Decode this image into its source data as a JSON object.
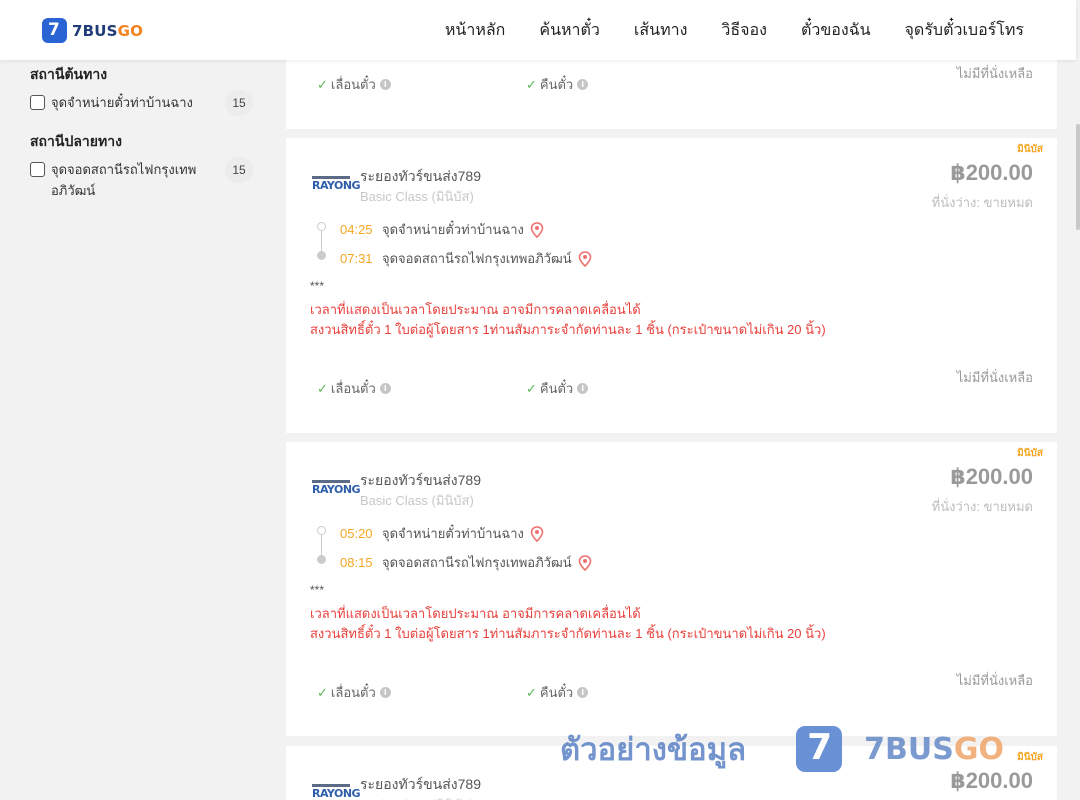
{
  "brand": {
    "mark": "7",
    "name_a": "7BUS",
    "name_b": "GO"
  },
  "nav": [
    "หน้าหลัก",
    "ค้นหาตั๋ว",
    "เส้นทาง",
    "วิธีจอง",
    "ตั๋วของฉัน",
    "จุดรับตั๋วเบอร์โทร"
  ],
  "filters": {
    "origin_title": "สถานีต้นทาง",
    "origin_items": [
      {
        "label": "จุดจำหน่ายตั๋วท่าบ้านฉาง",
        "count": "15"
      }
    ],
    "dest_title": "สถานีปลายทาง",
    "dest_items": [
      {
        "label": "จุดจอดสถานีรถไฟกรุงเทพอภิวัฒน์",
        "count": "15"
      }
    ]
  },
  "partial_card": {
    "reschedule": "เลื่อนตั๋ว",
    "refund": "คืนตั๋ว",
    "availability": "ไม่มีที่นั่งเหลือ"
  },
  "trips": [
    {
      "vehicle_tag": "มินิบัส",
      "operator_logo": "RAYONG",
      "operator": "ระยองทัวร์ขนส่ง789",
      "class": "Basic Class (มินิบัส)",
      "price": "฿200.00",
      "seats": "ที่นั่งว่าง: ขายหมด",
      "depart_time": "04:25",
      "depart_place": "จุดจำหน่ายตั๋วท่าบ้านฉาง",
      "arrive_time": "07:31",
      "arrive_place": "จุดจอดสถานีรถไฟกรุงเทพอภิวัฒน์",
      "note_stars": "***",
      "note1": "เวลาที่แสดงเป็นเวลาโดยประมาณ อาจมีการคลาดเคลื่อนได้",
      "note2": "สงวนสิทธิ์ตั๋ว 1 ใบต่อผู้โดยสาร 1ท่านสัมภาระจำกัดท่านละ 1 ชิ้น (กระเป๋าขนาดไม่เกิน 20 นิ้ว)",
      "reschedule": "เลื่อนตั๋ว",
      "refund": "คืนตั๋ว",
      "availability": "ไม่มีที่นั่งเหลือ"
    },
    {
      "vehicle_tag": "มินิบัส",
      "operator_logo": "RAYONG",
      "operator": "ระยองทัวร์ขนส่ง789",
      "class": "Basic Class (มินิบัส)",
      "price": "฿200.00",
      "seats": "ที่นั่งว่าง: ขายหมด",
      "depart_time": "05:20",
      "depart_place": "จุดจำหน่ายตั๋วท่าบ้านฉาง",
      "arrive_time": "08:15",
      "arrive_place": "จุดจอดสถานีรถไฟกรุงเทพอภิวัฒน์",
      "note_stars": "***",
      "note1": "เวลาที่แสดงเป็นเวลาโดยประมาณ อาจมีการคลาดเคลื่อนได้",
      "note2": "สงวนสิทธิ์ตั๋ว 1 ใบต่อผู้โดยสาร 1ท่านสัมภาระจำกัดท่านละ 1 ชิ้น (กระเป๋าขนาดไม่เกิน 20 นิ้ว)",
      "reschedule": "เลื่อนตั๋ว",
      "refund": "คืนตั๋ว",
      "availability": "ไม่มีที่นั่งเหลือ"
    },
    {
      "vehicle_tag": "มินิบัส",
      "operator_logo": "RAYONG",
      "operator": "ระยองทัวร์ขนส่ง789",
      "class": "Basic Class (มินิบัส)",
      "price": "฿200.00"
    }
  ],
  "watermark": {
    "text": "ตัวอย่างข้อมูล",
    "mark": "7",
    "logo_a": "7BUS",
    "logo_b": "GO"
  },
  "colors": {
    "accent": "#f5a623",
    "brand_blue": "#2a63d4",
    "warning_red": "#e8413c",
    "check_green": "#5cb85c"
  }
}
